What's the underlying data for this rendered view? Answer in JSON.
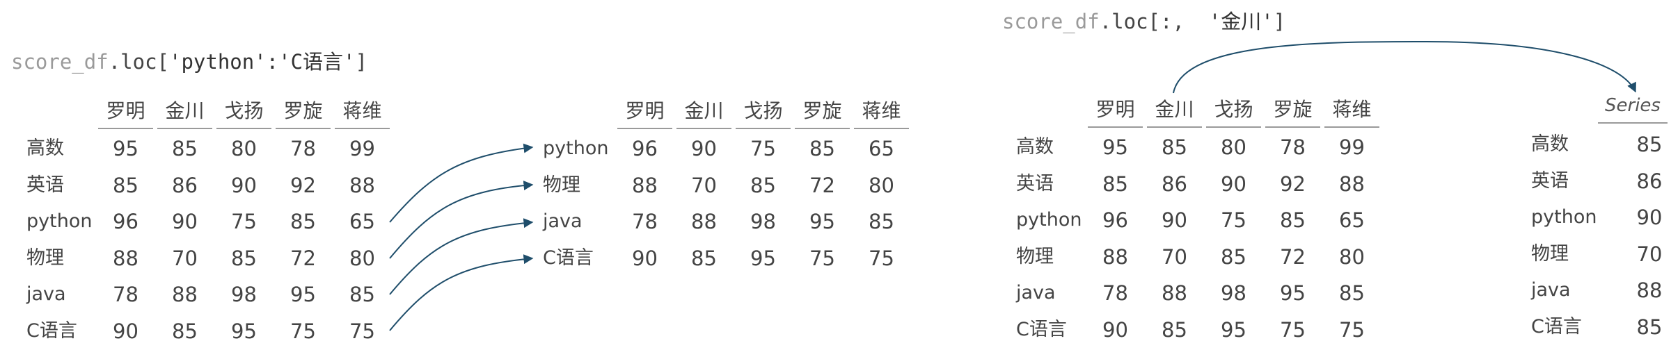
{
  "left_code": {
    "obj": "score_df",
    "method": ".loc[",
    "arg": "'python':'C语言'",
    "close": "]"
  },
  "right_code": {
    "obj": "score_df",
    "method": ".loc[:,  ",
    "arg": "'金川'",
    "close": "]"
  },
  "columns": [
    "罗明",
    "金川",
    "戈扬",
    "罗旋",
    "蒋维"
  ],
  "full_table": [
    {
      "index": "高数",
      "values": [
        95,
        85,
        80,
        78,
        99
      ]
    },
    {
      "index": "英语",
      "values": [
        85,
        86,
        90,
        92,
        88
      ]
    },
    {
      "index": "python",
      "values": [
        96,
        90,
        75,
        85,
        65
      ]
    },
    {
      "index": "物理",
      "values": [
        88,
        70,
        85,
        72,
        80
      ]
    },
    {
      "index": "java",
      "values": [
        78,
        88,
        98,
        95,
        85
      ]
    },
    {
      "index": "C语言",
      "values": [
        90,
        85,
        95,
        75,
        75
      ]
    }
  ],
  "sliced_table": [
    {
      "index": "python",
      "values": [
        96,
        90,
        75,
        85,
        65
      ]
    },
    {
      "index": "物理",
      "values": [
        88,
        70,
        85,
        72,
        80
      ]
    },
    {
      "index": "java",
      "values": [
        78,
        88,
        98,
        95,
        85
      ]
    },
    {
      "index": "C语言",
      "values": [
        90,
        85,
        95,
        75,
        75
      ]
    }
  ],
  "series": {
    "header": "Series",
    "rows": [
      {
        "index": "高数",
        "value": 85
      },
      {
        "index": "英语",
        "value": 86
      },
      {
        "index": "python",
        "value": 90
      },
      {
        "index": "物理",
        "value": 70
      },
      {
        "index": "java",
        "value": 88
      },
      {
        "index": "C语言",
        "value": 85
      }
    ]
  },
  "colors": {
    "arrow": "#1f4e6b",
    "rule": "#9a9a9a",
    "code_object": "#9a9a9a"
  }
}
